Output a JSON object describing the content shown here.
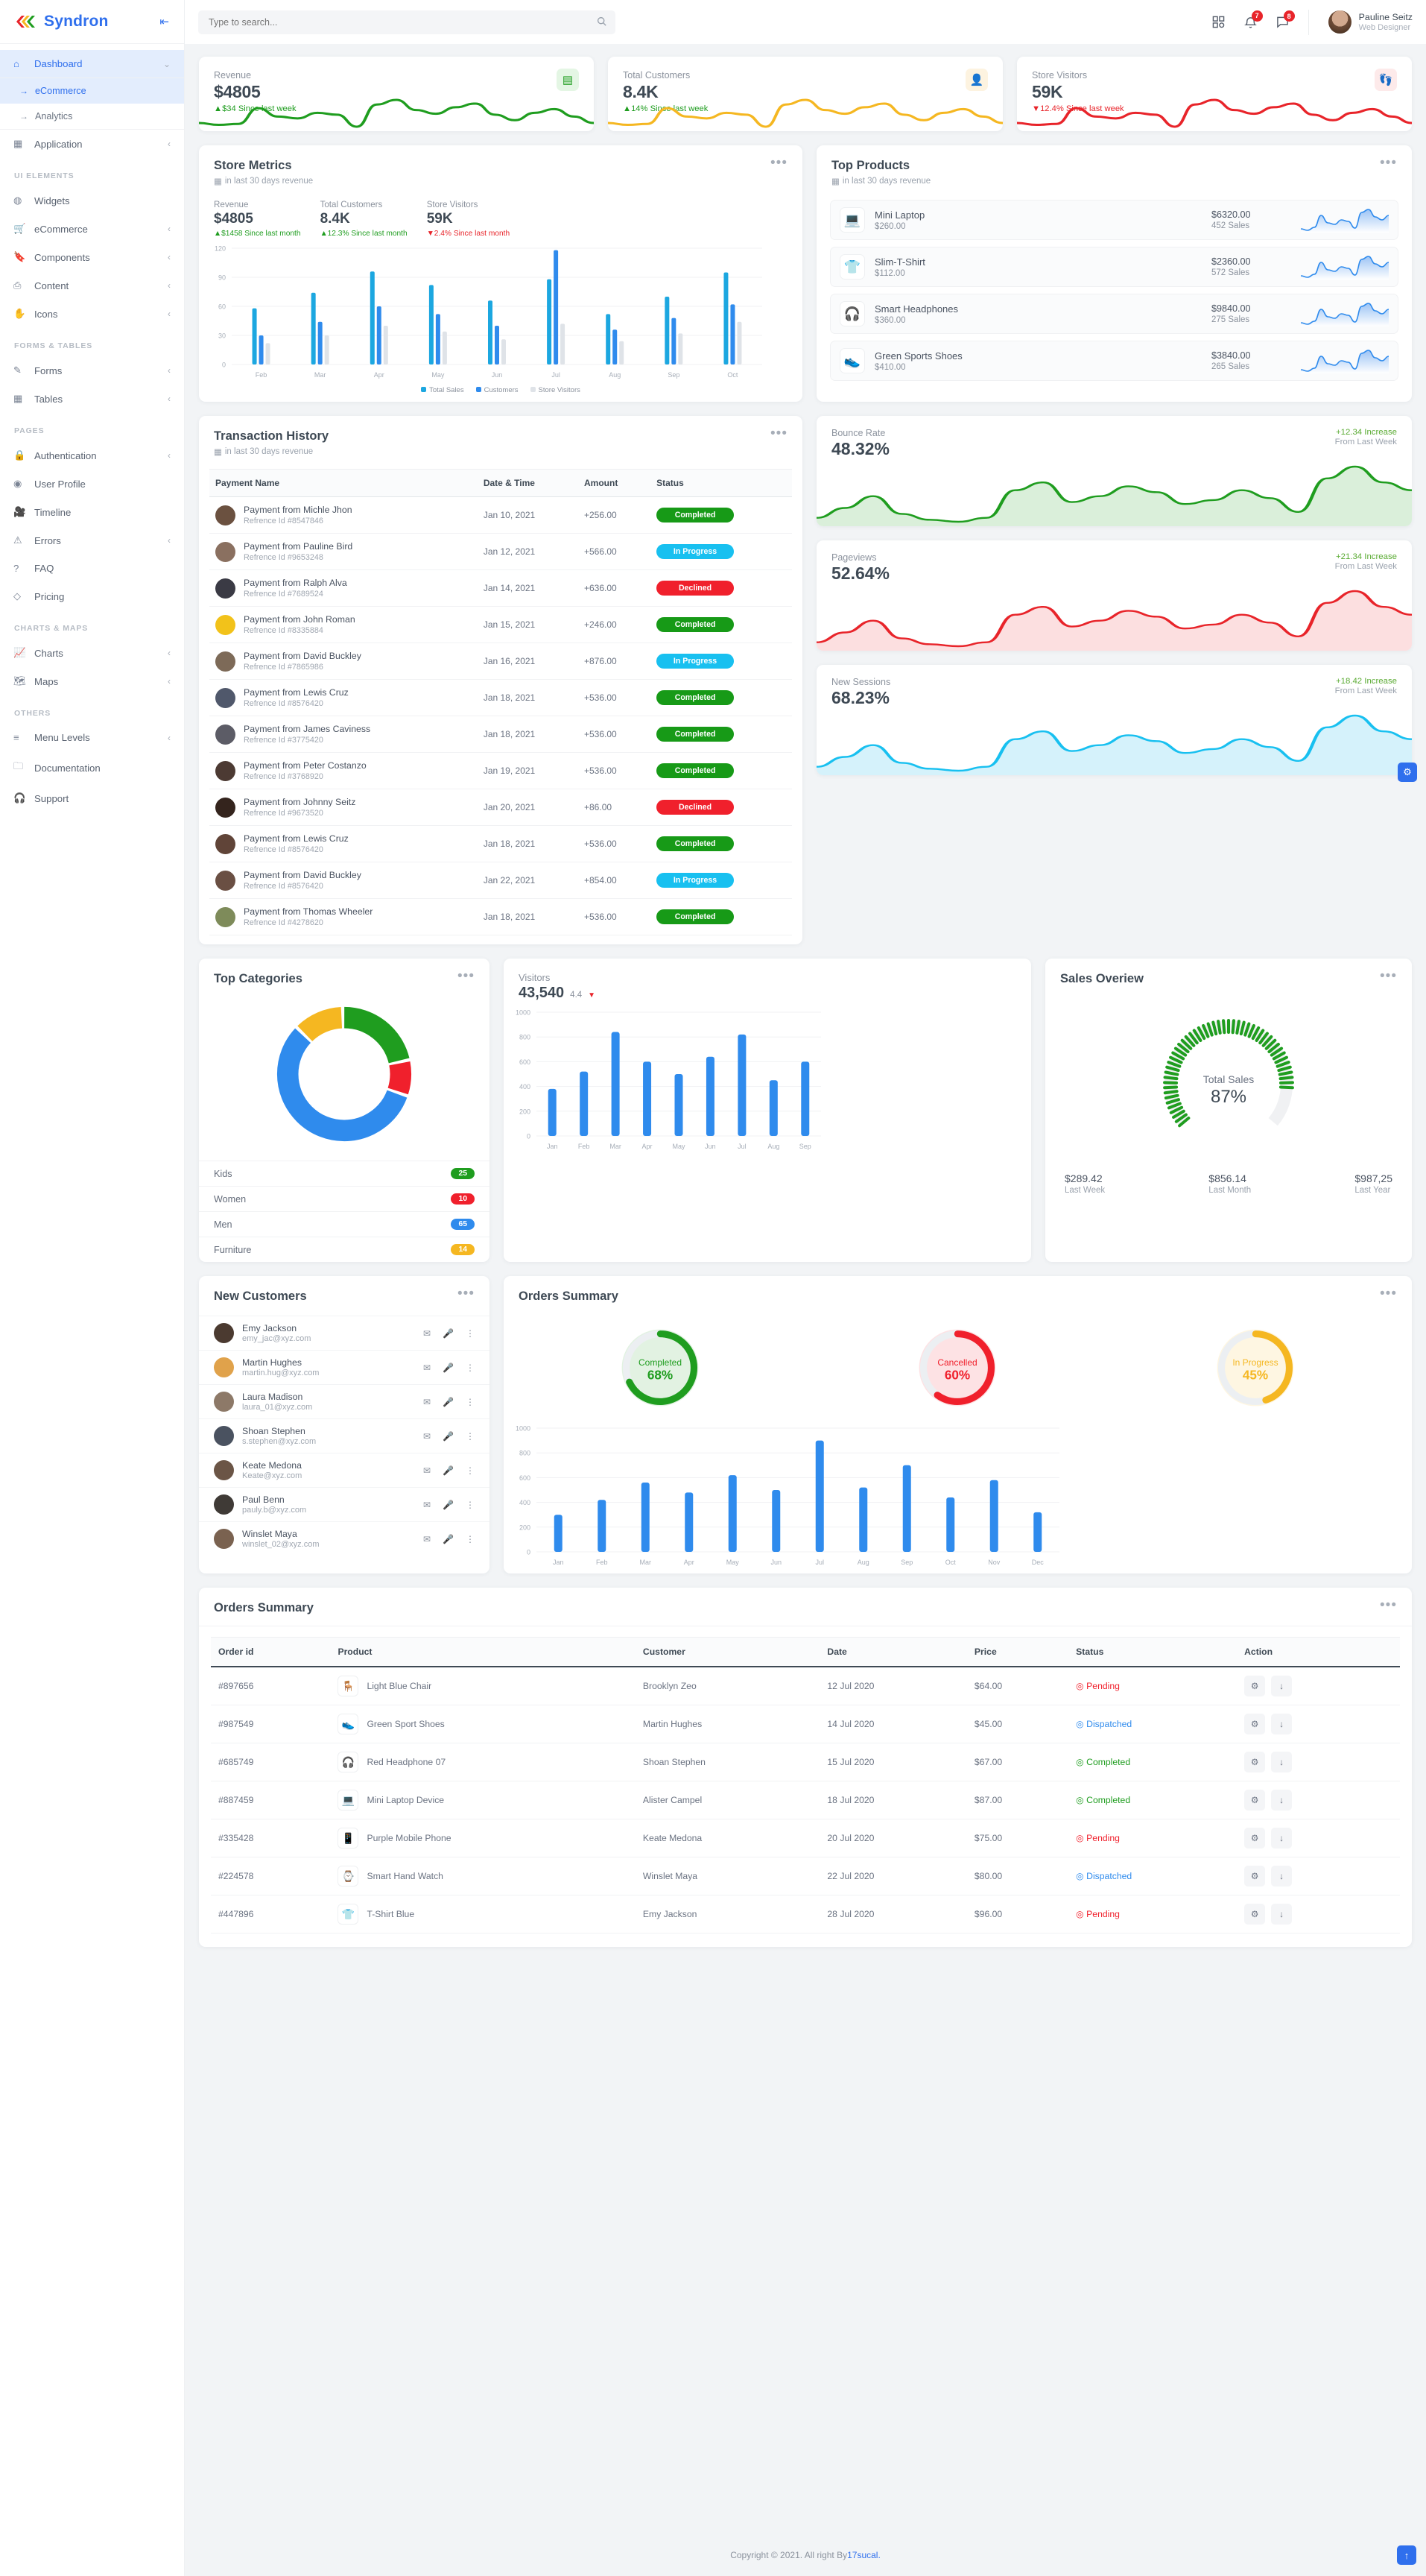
{
  "brand": {
    "title": "Syndron",
    "collapse_icon": "collapse-icon"
  },
  "search": {
    "placeholder": "Type to search...",
    "value": ""
  },
  "header": {
    "apps_icon": "grid-apps-icon",
    "notification_count": "7",
    "message_count": "8",
    "user": {
      "name": "Pauline Seitz",
      "role": "Web Designer"
    }
  },
  "sidebar": {
    "groups": [
      {
        "label": "",
        "items": [
          {
            "label": "Dashboard",
            "icon": "home-icon",
            "active": true,
            "arrow": "chevron-down"
          },
          {
            "label": "Application",
            "icon": "apps-grid-icon",
            "arrow": "chevron-left"
          }
        ]
      },
      {
        "label": "UI ELEMENTS",
        "items": [
          {
            "label": "Widgets",
            "icon": "cookie-icon",
            "arrow": ""
          },
          {
            "label": "eCommerce",
            "icon": "cart-icon",
            "arrow": "chevron-left"
          },
          {
            "label": "Components",
            "icon": "bookmark-icon",
            "arrow": "chevron-left"
          },
          {
            "label": "Content",
            "icon": "content-icon",
            "arrow": "chevron-left"
          },
          {
            "label": "Icons",
            "icon": "hand-icon",
            "arrow": "chevron-left"
          }
        ]
      },
      {
        "label": "FORMS & TABLES",
        "items": [
          {
            "label": "Forms",
            "icon": "edit-square-icon",
            "arrow": "chevron-left"
          },
          {
            "label": "Tables",
            "icon": "table-grid-icon",
            "arrow": "chevron-left"
          }
        ]
      },
      {
        "label": "PAGES",
        "items": [
          {
            "label": "Authentication",
            "icon": "lock-icon",
            "arrow": "chevron-left"
          },
          {
            "label": "User Profile",
            "icon": "user-circle-icon",
            "arrow": ""
          },
          {
            "label": "Timeline",
            "icon": "video-icon",
            "arrow": ""
          },
          {
            "label": "Errors",
            "icon": "warning-icon",
            "arrow": "chevron-left"
          },
          {
            "label": "FAQ",
            "icon": "question-circle-icon",
            "arrow": ""
          },
          {
            "label": "Pricing",
            "icon": "diamond-icon",
            "arrow": ""
          }
        ]
      },
      {
        "label": "CHARTS & MAPS",
        "items": [
          {
            "label": "Charts",
            "icon": "line-chart-icon",
            "arrow": "chevron-left"
          },
          {
            "label": "Maps",
            "icon": "map-icon",
            "arrow": "chevron-left"
          }
        ]
      },
      {
        "label": "OTHERS",
        "items": [
          {
            "label": "Menu Levels",
            "icon": "hamburger-icon",
            "arrow": "chevron-left"
          },
          {
            "label": "Documentation",
            "icon": "folder-icon",
            "arrow": ""
          },
          {
            "label": "Support",
            "icon": "headset-icon",
            "arrow": ""
          }
        ]
      }
    ],
    "dashboard_subitems": [
      {
        "label": "eCommerce",
        "active": true
      },
      {
        "label": "Analytics",
        "active": false
      }
    ]
  },
  "stat_cards": [
    {
      "label": "Revenue",
      "value": "$4805",
      "delta": "▲$34 Since last week",
      "delta_color": "#1f9d1f",
      "icon": "wallet-icon",
      "icon_bg": "#e4f6e4",
      "icon_color": "#1f9d1f",
      "line_color": "#1f9d1f"
    },
    {
      "label": "Total Customers",
      "value": "8.4K",
      "delta": "▲14% Since last week",
      "delta_color": "#1f9d1f",
      "icon": "user-icon",
      "icon_bg": "#fdf3e0",
      "icon_color": "#f0a518",
      "line_color": "#f5b721"
    },
    {
      "label": "Store Visitors",
      "value": "59K",
      "delta": "▼12.4% Since last week",
      "delta_color": "#e8242a",
      "icon": "footprint-icon",
      "icon_bg": "#fdeaea",
      "icon_color": "#e8242a",
      "line_color": "#e8242a"
    }
  ],
  "store_metrics": {
    "title": "Store Metrics",
    "subtitle": "in last 30 days revenue",
    "metrics": [
      {
        "label": "Revenue",
        "value": "$4805",
        "delta": "▲$1458 Since last month",
        "dir": "up"
      },
      {
        "label": "Total Customers",
        "value": "8.4K",
        "delta": "▲12.3% Since last month",
        "dir": "up"
      },
      {
        "label": "Store Visitors",
        "value": "59K",
        "delta": "▼2.4% Since last month",
        "dir": "down"
      }
    ],
    "legend": [
      {
        "label": "Total Sales",
        "color": "#1ca7e0"
      },
      {
        "label": "Customers",
        "color": "#2f8bed"
      },
      {
        "label": "Store Visitors",
        "color": "#dfe3e8"
      }
    ]
  },
  "top_products": {
    "title": "Top Products",
    "subtitle": "in last 30 days revenue",
    "items": [
      {
        "name": "Mini Laptop",
        "price": "$260.00",
        "revenue": "$6320.00",
        "sales": "452 Sales",
        "icon": "laptop-icon"
      },
      {
        "name": "Slim-T-Shirt",
        "price": "$112.00",
        "revenue": "$2360.00",
        "sales": "572 Sales",
        "icon": "tshirt-icon"
      },
      {
        "name": "Smart Headphones",
        "price": "$360.00",
        "revenue": "$9840.00",
        "sales": "275 Sales",
        "icon": "headphones-icon"
      },
      {
        "name": "Green Sports Shoes",
        "price": "$410.00",
        "revenue": "$3840.00",
        "sales": "265 Sales",
        "icon": "shoe-icon"
      }
    ]
  },
  "transactions": {
    "title": "Transaction History",
    "subtitle": "in last 30 days revenue",
    "columns": [
      "Payment Name",
      "Date & Time",
      "Amount",
      "Status"
    ],
    "rows": [
      {
        "name": "Payment from Michle Jhon",
        "ref": "Refrence Id #8547846",
        "date": "Jan 10, 2021",
        "amount": "+256.00",
        "status": "Completed",
        "status_class": "completed",
        "av": "#6b5140"
      },
      {
        "name": "Payment from Pauline Bird",
        "ref": "Refrence Id #9653248",
        "date": "Jan 12, 2021",
        "amount": "+566.00",
        "status": "In Progress",
        "status_class": "progress",
        "av": "#8a7060"
      },
      {
        "name": "Payment from Ralph Alva",
        "ref": "Refrence Id #7689524",
        "date": "Jan 14, 2021",
        "amount": "+636.00",
        "status": "Declined",
        "status_class": "declined",
        "av": "#3a3a44"
      },
      {
        "name": "Payment from John Roman",
        "ref": "Refrence Id #8335884",
        "date": "Jan 15, 2021",
        "amount": "+246.00",
        "status": "Completed",
        "status_class": "completed",
        "av": "#f2c21a"
      },
      {
        "name": "Payment from David Buckley",
        "ref": "Refrence Id #7865986",
        "date": "Jan 16, 2021",
        "amount": "+876.00",
        "status": "In Progress",
        "status_class": "progress",
        "av": "#7d6a58"
      },
      {
        "name": "Payment from Lewis Cruz",
        "ref": "Refrence Id #8576420",
        "date": "Jan 18, 2021",
        "amount": "+536.00",
        "status": "Completed",
        "status_class": "completed",
        "av": "#50586b"
      },
      {
        "name": "Payment from James Caviness",
        "ref": "Refrence Id #3775420",
        "date": "Jan 18, 2021",
        "amount": "+536.00",
        "status": "Completed",
        "status_class": "completed",
        "av": "#5c5c66"
      },
      {
        "name": "Payment from Peter Costanzo",
        "ref": "Refrence Id #3768920",
        "date": "Jan 19, 2021",
        "amount": "+536.00",
        "status": "Completed",
        "status_class": "completed",
        "av": "#4c3a33"
      },
      {
        "name": "Payment from Johnny Seitz",
        "ref": "Refrence Id #9673520",
        "date": "Jan 20, 2021",
        "amount": "+86.00",
        "status": "Declined",
        "status_class": "declined",
        "av": "#34241d"
      },
      {
        "name": "Payment from Lewis Cruz",
        "ref": "Refrence Id #8576420",
        "date": "Jan 18, 2021",
        "amount": "+536.00",
        "status": "Completed",
        "status_class": "completed",
        "av": "#604438"
      },
      {
        "name": "Payment from David Buckley",
        "ref": "Refrence Id #8576420",
        "date": "Jan 22, 2021",
        "amount": "+854.00",
        "status": "In Progress",
        "status_class": "progress",
        "av": "#6a4f43"
      },
      {
        "name": "Payment from Thomas Wheeler",
        "ref": "Refrence Id #4278620",
        "date": "Jan 18, 2021",
        "amount": "+536.00",
        "status": "Completed",
        "status_class": "completed",
        "av": "#7e8b5a"
      }
    ]
  },
  "analytics_cards": [
    {
      "label": "Bounce Rate",
      "value": "48.32%",
      "increase": "+12.34 Increase",
      "from": "From Last Week",
      "color": "#1f9d1f",
      "fill": "#cdeac d"
    },
    {
      "label": "Pageviews",
      "value": "52.64%",
      "increase": "+21.34 Increase",
      "from": "From Last Week",
      "color": "#e8242a",
      "fill": "#fbd4d6"
    },
    {
      "label": "New Sessions",
      "value": "68.23%",
      "increase": "+18.42 Increase",
      "from": "From Last Week",
      "color": "#18c0f0",
      "fill": "#c7eefa"
    }
  ],
  "top_categories": {
    "title": "Top Categories",
    "rows": [
      {
        "label": "Kids",
        "value": "25",
        "color": "#1f9d1f"
      },
      {
        "label": "Women",
        "value": "10",
        "color": "#f0202c"
      },
      {
        "label": "Men",
        "value": "65",
        "color": "#2f8bed"
      },
      {
        "label": "Furniture",
        "value": "14",
        "color": "#f5b721"
      }
    ]
  },
  "visitors": {
    "title": "Visitors",
    "value": "43,540",
    "delta": "4.4",
    "delta_icon": "▼"
  },
  "sales_overview": {
    "title": "Sales Overiew",
    "gauge_label": "Total Sales",
    "gauge_value": "87%",
    "gauge_pct": 87,
    "stats": [
      {
        "value": "$289.42",
        "label": "Last Week"
      },
      {
        "value": "$856.14",
        "label": "Last Month"
      },
      {
        "value": "$987,25",
        "label": "Last Year"
      }
    ]
  },
  "new_customers": {
    "title": "New Customers",
    "rows": [
      {
        "name": "Emy Jackson",
        "email": "emy_jac@xyz.com",
        "av": "#4b3a30"
      },
      {
        "name": "Martin Hughes",
        "email": "martin.hug@xyz.com",
        "av": "#e0a24b"
      },
      {
        "name": "Laura Madison",
        "email": "laura_01@xyz.com",
        "av": "#8d7968"
      },
      {
        "name": "Shoan Stephen",
        "email": "s.stephen@xyz.com",
        "av": "#4a5260"
      },
      {
        "name": "Keate Medona",
        "email": "Keate@xyz.com",
        "av": "#6b5546"
      },
      {
        "name": "Paul Benn",
        "email": "pauly.b@xyz.com",
        "av": "#3f3a36"
      },
      {
        "name": "Winslet Maya",
        "email": "winslet_02@xyz.com",
        "av": "#7a6250"
      }
    ],
    "action_icons": [
      "mail-icon",
      "mic-icon",
      "more-vertical-icon"
    ]
  },
  "orders_summary_top": {
    "title": "Orders Summary",
    "donuts": [
      {
        "label": "Completed",
        "value": "68%",
        "pct": 68,
        "color": "#1f9d1f"
      },
      {
        "label": "Cancelled",
        "value": "60%",
        "pct": 60,
        "color": "#f0202c"
      },
      {
        "label": "In Progress",
        "value": "45%",
        "pct": 45,
        "color": "#f5b721"
      }
    ]
  },
  "orders_table": {
    "title": "Orders Summary",
    "columns": [
      "Order id",
      "Product",
      "Customer",
      "Date",
      "Price",
      "Status",
      "Action"
    ],
    "rows": [
      {
        "id": "#897656",
        "product": "Light Blue Chair",
        "icon": "chair-icon",
        "customer": "Brooklyn Zeo",
        "date": "12 Jul 2020",
        "price": "$64.00",
        "status": "Pending",
        "status_class": "st-pending"
      },
      {
        "id": "#987549",
        "product": "Green Sport Shoes",
        "icon": "shoe-icon",
        "customer": "Martin Hughes",
        "date": "14 Jul 2020",
        "price": "$45.00",
        "status": "Dispatched",
        "status_class": "st-dispatched"
      },
      {
        "id": "#685749",
        "product": "Red Headphone 07",
        "icon": "headphones-icon",
        "customer": "Shoan Stephen",
        "date": "15 Jul 2020",
        "price": "$67.00",
        "status": "Completed",
        "status_class": "st-completed"
      },
      {
        "id": "#887459",
        "product": "Mini Laptop Device",
        "icon": "laptop-icon",
        "customer": "Alister Campel",
        "date": "18 Jul 2020",
        "price": "$87.00",
        "status": "Completed",
        "status_class": "st-completed"
      },
      {
        "id": "#335428",
        "product": "Purple Mobile Phone",
        "icon": "phone-icon",
        "customer": "Keate Medona",
        "date": "20 Jul 2020",
        "price": "$75.00",
        "status": "Pending",
        "status_class": "st-pending"
      },
      {
        "id": "#224578",
        "product": "Smart Hand Watch",
        "icon": "watch-icon",
        "customer": "Winslet Maya",
        "date": "22 Jul 2020",
        "price": "$80.00",
        "status": "Dispatched",
        "status_class": "st-dispatched"
      },
      {
        "id": "#447896",
        "product": "T-Shirt Blue",
        "icon": "tshirt-icon",
        "customer": "Emy Jackson",
        "date": "28 Jul 2020",
        "price": "$96.00",
        "status": "Pending",
        "status_class": "st-pending"
      }
    ]
  },
  "footer": {
    "text": "Copyright © 2021. All right By ",
    "link": "17sucal."
  },
  "chart_data": [
    {
      "type": "bar",
      "name": "store-metrics-bar",
      "title": "Store Metrics",
      "categories": [
        "Feb",
        "Mar",
        "Apr",
        "May",
        "Jun",
        "Jul",
        "Aug",
        "Sep",
        "Oct"
      ],
      "series": [
        {
          "name": "Total Sales",
          "color": "#1ca7e0",
          "values": [
            58,
            74,
            96,
            82,
            66,
            88,
            52,
            70,
            95
          ]
        },
        {
          "name": "Customers",
          "color": "#2f8bed",
          "values": [
            30,
            44,
            60,
            52,
            40,
            118,
            36,
            48,
            62
          ]
        },
        {
          "name": "Store Visitors",
          "color": "#dfe3e8",
          "values": [
            22,
            30,
            40,
            34,
            26,
            42,
            24,
            32,
            44
          ]
        }
      ],
      "ylim": [
        0,
        120
      ],
      "yticks": [
        0,
        30,
        60,
        90,
        120
      ],
      "grid": true,
      "legend": "bottom"
    },
    {
      "type": "bar",
      "name": "visitors-bar",
      "title": "Visitors",
      "categories": [
        "Jan",
        "Feb",
        "Mar",
        "Apr",
        "May",
        "Jun",
        "Jul",
        "Aug",
        "Sep"
      ],
      "values": [
        380,
        520,
        840,
        600,
        500,
        640,
        820,
        450,
        600
      ],
      "ylim": [
        0,
        1000
      ],
      "yticks": [
        0,
        200,
        400,
        600,
        800,
        1000
      ],
      "color": "#2f8bed",
      "grid": true
    },
    {
      "type": "bar",
      "name": "orders-summary-bar",
      "title": "Orders Summary",
      "categories": [
        "Jan",
        "Feb",
        "Mar",
        "Apr",
        "May",
        "Jun",
        "Jul",
        "Aug",
        "Sep",
        "Oct",
        "Nov",
        "Dec"
      ],
      "values": [
        300,
        420,
        560,
        480,
        620,
        500,
        900,
        520,
        700,
        440,
        580,
        320
      ],
      "ylim": [
        0,
        1000
      ],
      "yticks": [
        0,
        200,
        400,
        600,
        800,
        1000
      ],
      "color": "#2f8bed",
      "grid": true
    },
    {
      "type": "pie",
      "name": "top-categories-donut",
      "title": "Top Categories",
      "labels": [
        "Kids",
        "Women",
        "Men",
        "Furniture"
      ],
      "values": [
        25,
        10,
        65,
        14
      ],
      "colors": [
        "#1f9d1f",
        "#f0202c",
        "#2f8bed",
        "#f5b721"
      ]
    },
    {
      "type": "pie",
      "name": "sales-overview-gauge",
      "title": "Sales Overiew",
      "labels": [
        "Total Sales"
      ],
      "values": [
        87
      ],
      "colors": [
        "#1f9d1f"
      ]
    }
  ]
}
